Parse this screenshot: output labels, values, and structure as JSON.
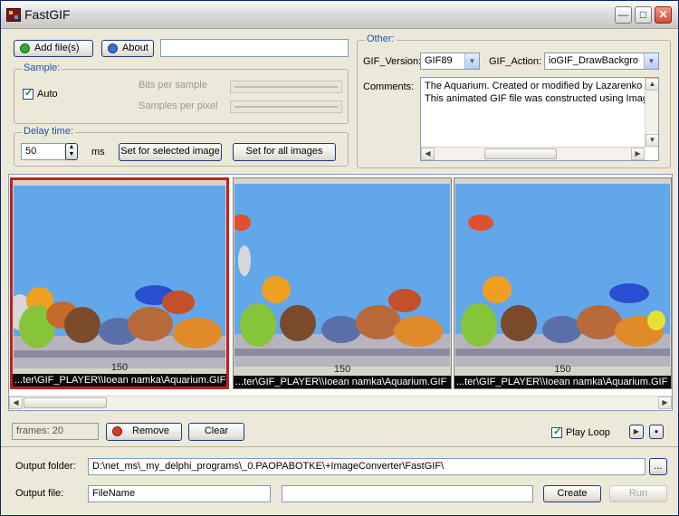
{
  "window": {
    "title": "FastGIF"
  },
  "toolbar": {
    "add_files_label": "Add file(s)",
    "about_label": "About",
    "top_input_value": ""
  },
  "sample": {
    "legend": "Sample:",
    "auto_label": "Auto",
    "auto_checked": true,
    "bits_label": "Bits per sample",
    "samples_label": "Samples per pixel"
  },
  "delay": {
    "legend": "Delay time:",
    "value": "50",
    "unit": "ms",
    "set_selected_label": "Set for selected image",
    "set_all_label": "Set for all images"
  },
  "other": {
    "legend": "Other:",
    "gif_version_label": "GIF_Version:",
    "gif_version_value": "GIF89",
    "gif_action_label": "GIF_Action:",
    "gif_action_value": "ioGIF_DrawBackgro",
    "comments_label": "Comments:",
    "comments_lines": [
      "The Aquarium. Created or modified by Lazarenko A.",
      "This animated GIF file was constructed using Image"
    ]
  },
  "frames": [
    {
      "number": "150",
      "path": "...ter\\GIF_PLAYER\\\\Ioean namka\\Aquarium.GIF",
      "selected": true
    },
    {
      "number": "150",
      "path": "...ter\\GIF_PLAYER\\\\Ioean namka\\Aquarium.GIF",
      "selected": false
    },
    {
      "number": "150",
      "path": "...ter\\GIF_PLAYER\\\\Ioean namka\\Aquarium.GIF",
      "selected": false
    }
  ],
  "status": {
    "frames_text": "frames: 20",
    "remove_label": "Remove",
    "clear_label": "Clear",
    "play_loop_label": "Play Loop",
    "play_loop_checked": true
  },
  "output": {
    "folder_label": "Output folder:",
    "folder_value": "D:\\net_ms\\_my_delphi_programs\\_0.PAOPABOTKE\\+ImageConverter\\FastGIF\\",
    "browse_label": "...",
    "file_label": "Output file:",
    "file_value": "FileName",
    "extra_value": "",
    "create_label": "Create",
    "run_label": "Run"
  },
  "colors": {
    "selection_border": "#c41e1e",
    "legend_blue": "#1f4fb0",
    "aquarium_water": "#62a7ea"
  }
}
